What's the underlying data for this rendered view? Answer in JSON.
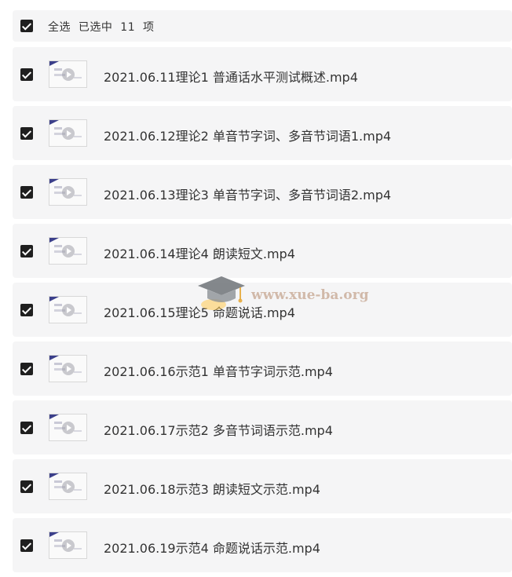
{
  "header": {
    "select_all_label": "全选",
    "selected_text": "已选中  11  项"
  },
  "files": [
    {
      "name": "2021.06.11理论1 普通话水平测试概述.mp4",
      "checked": true,
      "icon": "video-thumbnail"
    },
    {
      "name": "2021.06.12理论2 单音节字词、多音节词语1.mp4",
      "checked": true,
      "icon": "video-thumbnail"
    },
    {
      "name": "2021.06.13理论3 单音节字词、多音节词语2.mp4",
      "checked": true,
      "icon": "video-thumbnail"
    },
    {
      "name": "2021.06.14理论4 朗读短文.mp4",
      "checked": true,
      "icon": "video-thumbnail"
    },
    {
      "name": "2021.06.15理论5 命题说话.mp4",
      "checked": true,
      "icon": "video-thumbnail"
    },
    {
      "name": "2021.06.16示范1 单音节字词示范.mp4",
      "checked": true,
      "icon": "video-thumbnail"
    },
    {
      "name": "2021.06.17示范2 多音节词语示范.mp4",
      "checked": true,
      "icon": "video-thumbnail"
    },
    {
      "name": "2021.06.18示范3 朗读短文示范.mp4",
      "checked": true,
      "icon": "video-thumbnail"
    },
    {
      "name": "2021.06.19示范4 命题说话示范.mp4",
      "checked": true,
      "icon": "video-thumbnail"
    }
  ],
  "watermark": {
    "text": "www.xue-ba.org"
  },
  "colors": {
    "row_background": "#f5f5f6",
    "checkbox": "#1f1f1f",
    "text": "#333333"
  }
}
